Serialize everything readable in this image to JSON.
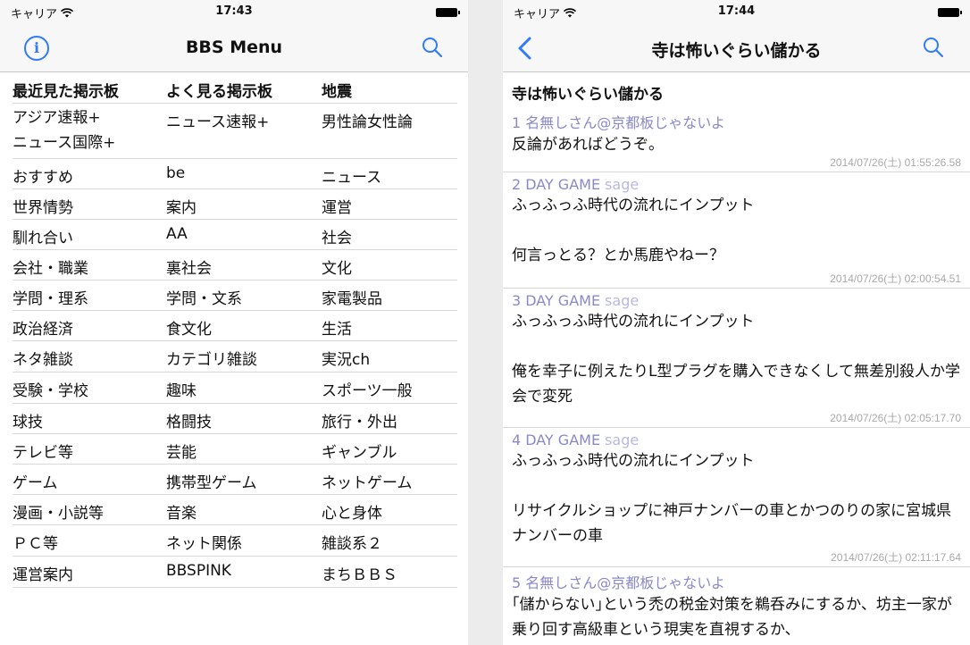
{
  "left": {
    "status": {
      "carrier": "キャリア",
      "time": "17:43"
    },
    "nav": {
      "title": "BBS Menu",
      "info_glyph": "i"
    },
    "menu": [
      [
        "最近見た掲示板",
        "よく見る掲示板",
        "地震"
      ],
      [
        "アジア速報+\nニュース国際+",
        "ニュース速報+",
        "男性論女性論"
      ],
      [
        "おすすめ",
        "be",
        "ニュース"
      ],
      [
        "世界情勢",
        "案内",
        "運営"
      ],
      [
        "馴れ合い",
        "AA",
        "社会"
      ],
      [
        "会社・職業",
        "裏社会",
        "文化"
      ],
      [
        "学問・理系",
        "学問・文系",
        "家電製品"
      ],
      [
        "政治経済",
        "食文化",
        "生活"
      ],
      [
        "ネタ雑談",
        "カテゴリ雑談",
        "実況ch"
      ],
      [
        "受験・学校",
        "趣味",
        "スポーツ一般"
      ],
      [
        "球技",
        "格闘技",
        "旅行・外出"
      ],
      [
        "テレビ等",
        "芸能",
        "ギャンブル"
      ],
      [
        "ゲーム",
        "携帯型ゲーム",
        "ネットゲーム"
      ],
      [
        "漫画・小説等",
        "音楽",
        "心と身体"
      ],
      [
        "ＰＣ等",
        "ネット関係",
        "雑談系２"
      ],
      [
        "運営案内",
        "BBSPINK",
        "まちＢＢＳ"
      ]
    ]
  },
  "right": {
    "status": {
      "carrier": "キャリア",
      "time": "17:44"
    },
    "nav": {
      "title": "寺は怖いぐらい儲かる"
    },
    "thread_title": "寺は怖いぐらい儲かる",
    "posts": [
      {
        "number": "1",
        "name": "名無しさん@京都板じゃないよ",
        "mail": "",
        "body": "反論があればどうぞ。",
        "timestamp": "2014/07/26(土) 01:55:26.58"
      },
      {
        "number": "2",
        "name": "DAY GAME",
        "mail": "sage",
        "body": "ふっふっふ時代の流れにインプット\n\n何言っとる？とか馬鹿やねー？",
        "timestamp": "2014/07/26(土) 02:00:54.51"
      },
      {
        "number": "3",
        "name": "DAY GAME",
        "mail": "sage",
        "body": "ふっふっふ時代の流れにインプット\n\n俺を幸子に例えたりL型プラグを購入できなくして無差別殺人か学会で変死",
        "timestamp": "2014/07/26(土) 02:05:17.70"
      },
      {
        "number": "4",
        "name": "DAY GAME",
        "mail": "sage",
        "body": "ふっふっふ時代の流れにインプット\n\nリサイクルショップに神戸ナンバーの車とかつのりの家に宮城県ナンバーの車",
        "timestamp": "2014/07/26(土) 02:11:17.64"
      },
      {
        "number": "5",
        "name": "名無しさん@京都板じゃないよ",
        "mail": "",
        "body": "｢儲からない｣という禿の税金対策を鵜呑みにするか、坊主一家が乗り回す高級車という現実を直視するか、",
        "timestamp": ""
      }
    ]
  },
  "colors": {
    "accent": "#2f7cf6",
    "post_name": "#8a88c8",
    "mail": "#b9b8e0",
    "timestamp": "#a9a9a9",
    "separator": "#d9d9d9"
  },
  "icons": {
    "info": "info-icon",
    "search": "search-icon",
    "back": "chevron-left-icon",
    "wifi": "wifi-icon",
    "battery": "battery-icon"
  }
}
